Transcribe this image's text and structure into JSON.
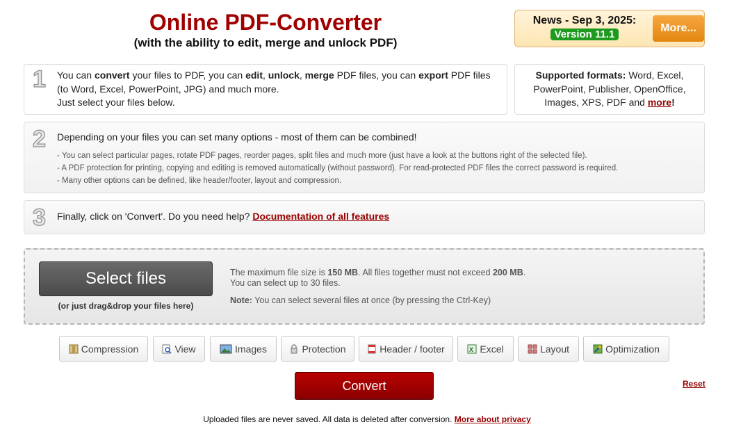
{
  "header": {
    "title": "Online PDF-Converter",
    "subtitle": "(with the ability to edit, merge and unlock PDF)"
  },
  "news": {
    "label": "News - Sep 3, 2025:",
    "version": "Version 11.1",
    "more_button": "More..."
  },
  "step1": {
    "number": "1",
    "t1": "You can ",
    "b1": "convert",
    "t2": " your files to PDF, you can ",
    "b2": "edit",
    "t3": ", ",
    "b3": "unlock",
    "t4": ", ",
    "b4": "merge",
    "t5": " PDF files, you can ",
    "b5": "export",
    "t6": " PDF files",
    "line2": "(to Word, Excel, PowerPoint, JPG) and much more.",
    "line3": "Just select your files below."
  },
  "formats": {
    "label": "Supported formats:",
    "list": " Word, Excel, PowerPoint, Publisher, OpenOffice, Images, XPS, PDF and ",
    "more_link": "more",
    "end": "!"
  },
  "step2": {
    "number": "2",
    "headline": "Depending on your files you can set many options - most of them can be combined!",
    "bullets": [
      "- You can select particular pages, rotate PDF pages, reorder pages, split files and much more (just have a look at the buttons right of the selected file).",
      "- A PDF protection for printing, copying and editing is removed automatically (without password). For read-protected PDF files the correct password is required.",
      "- Many other options can be defined, like header/footer, layout and compression."
    ]
  },
  "step3": {
    "number": "3",
    "text": "Finally, click on 'Convert'. Do you need help? ",
    "link": "Documentation of all features"
  },
  "upload": {
    "select_button": "Select files",
    "drag_hint": "(or just drag&drop your files here)",
    "info1a": "The maximum file size is ",
    "info1b": "150 MB",
    "info1c": ". All files together must not exceed ",
    "info1d": "200 MB",
    "info1e": ".",
    "info2": "You can select up to 30 files.",
    "note_label": "Note:",
    "note_text": " You can select several files at once (by pressing the Ctrl-Key)"
  },
  "options": [
    {
      "label": "Compression",
      "icon": "compression-icon"
    },
    {
      "label": "View",
      "icon": "view-icon"
    },
    {
      "label": "Images",
      "icon": "images-icon"
    },
    {
      "label": "Protection",
      "icon": "protection-icon"
    },
    {
      "label": "Header / footer",
      "icon": "header-footer-icon"
    },
    {
      "label": "Excel",
      "icon": "excel-icon"
    },
    {
      "label": "Layout",
      "icon": "layout-icon"
    },
    {
      "label": "Optimization",
      "icon": "optimization-icon"
    }
  ],
  "actions": {
    "convert": "Convert",
    "reset": "Reset"
  },
  "footer": {
    "text": "Uploaded files are never saved. All data is deleted after conversion. ",
    "link": "More about privacy"
  },
  "colors": {
    "brand_red": "#a00000",
    "convert_red": "#9e0000",
    "version_green": "#1e9a1e",
    "more_orange": "#e38610"
  }
}
